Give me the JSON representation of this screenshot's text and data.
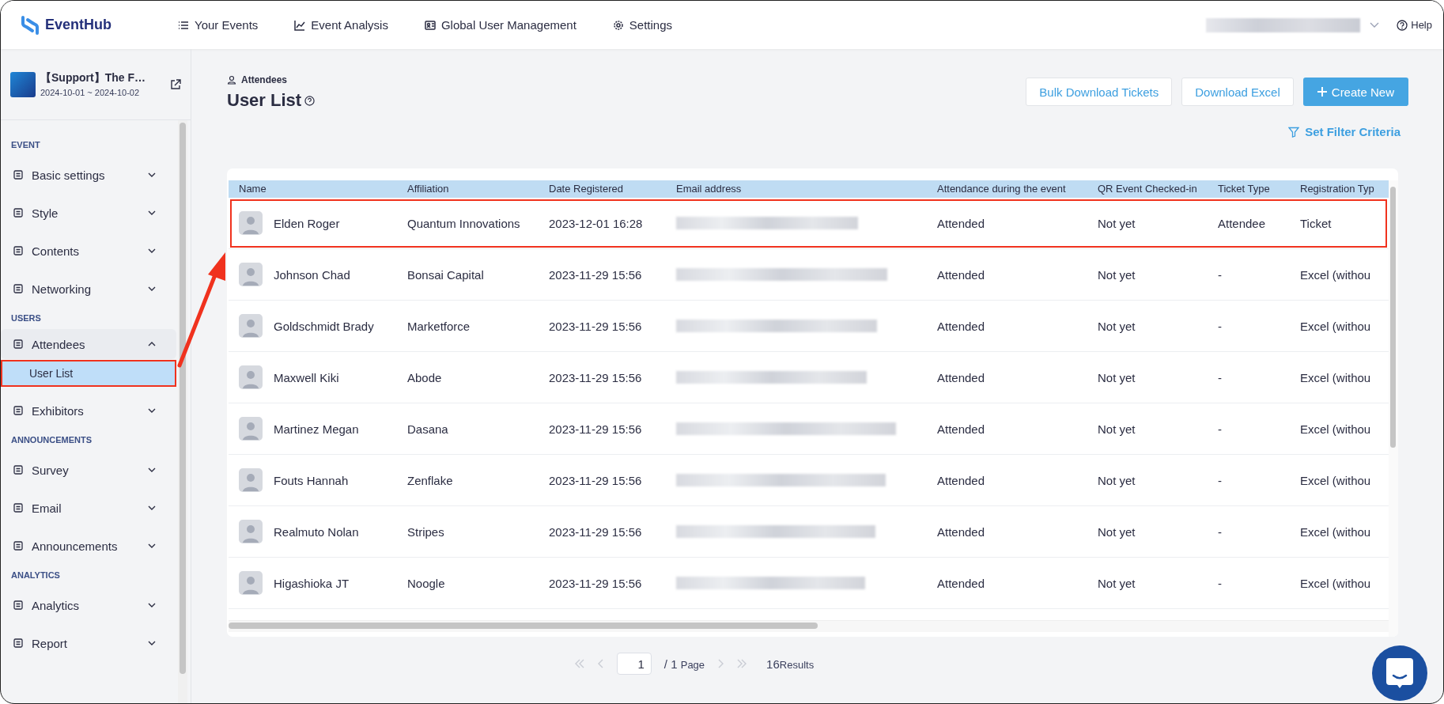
{
  "app": {
    "name": "EventHub",
    "nav": [
      "Your Events",
      "Event Analysis",
      "Global User Management",
      "Settings"
    ],
    "help": "Help"
  },
  "event": {
    "title": "【Support】The F…",
    "dates": "2024-10-01 ~ 2024-10-02"
  },
  "sidebar": {
    "sections": [
      {
        "label": "EVENT",
        "items": [
          {
            "label": "Basic settings",
            "expanded": false
          },
          {
            "label": "Style",
            "expanded": false
          },
          {
            "label": "Contents",
            "expanded": false
          },
          {
            "label": "Networking",
            "expanded": false
          }
        ]
      },
      {
        "label": "USERS",
        "items": [
          {
            "label": "Attendees",
            "expanded": true,
            "children": [
              {
                "label": "User List",
                "selected": true,
                "highlighted": true
              }
            ]
          },
          {
            "label": "Exhibitors",
            "expanded": false
          }
        ]
      },
      {
        "label": "ANNOUNCEMENTS",
        "items": [
          {
            "label": "Survey",
            "expanded": false
          },
          {
            "label": "Email",
            "expanded": false
          },
          {
            "label": "Announcements",
            "expanded": false
          }
        ]
      },
      {
        "label": "ANALYTICS",
        "items": [
          {
            "label": "Analytics",
            "expanded": false
          },
          {
            "label": "Report",
            "expanded": false
          }
        ]
      }
    ]
  },
  "page": {
    "breadcrumb": "Attendees",
    "title": "User List",
    "buttons": [
      {
        "label": "Bulk Download Tickets",
        "kind": "outline"
      },
      {
        "label": "Download Excel",
        "kind": "outline"
      },
      {
        "label": "Create New",
        "kind": "primary"
      }
    ],
    "filter": "Set Filter Criteria"
  },
  "table": {
    "columns": [
      "Name",
      "Affiliation",
      "Date Registered",
      "Email address",
      "Attendance during the event",
      "QR Event Checked-in",
      "Ticket Type",
      "Registration Typ"
    ],
    "rows": [
      {
        "highlighted": true,
        "cells": [
          "Elden Roger",
          "Quantum Innovations",
          "2023-12-01 16:28",
          "",
          "Attended",
          "Not yet",
          "Attendee",
          "Ticket"
        ]
      },
      {
        "highlighted": false,
        "cells": [
          "Johnson Chad",
          "Bonsai Capital",
          "2023-11-29 15:56",
          "",
          "Attended",
          "Not yet",
          "-",
          "Excel (withou"
        ]
      },
      {
        "highlighted": false,
        "cells": [
          "Goldschmidt Brady",
          "Marketforce",
          "2023-11-29 15:56",
          "",
          "Attended",
          "Not yet",
          "-",
          "Excel (withou"
        ]
      },
      {
        "highlighted": false,
        "cells": [
          "Maxwell Kiki",
          "Abode",
          "2023-11-29 15:56",
          "",
          "Attended",
          "Not yet",
          "-",
          "Excel (withou"
        ]
      },
      {
        "highlighted": false,
        "cells": [
          "Martinez Megan",
          "Dasana",
          "2023-11-29 15:56",
          "",
          "Attended",
          "Not yet",
          "-",
          "Excel (withou"
        ]
      },
      {
        "highlighted": false,
        "cells": [
          "Fouts Hannah",
          "Zenflake",
          "2023-11-29 15:56",
          "",
          "Attended",
          "Not yet",
          "-",
          "Excel (withou"
        ]
      },
      {
        "highlighted": false,
        "cells": [
          "Realmuto Nolan",
          "Stripes",
          "2023-11-29 15:56",
          "",
          "Attended",
          "Not yet",
          "-",
          "Excel (withou"
        ]
      },
      {
        "highlighted": false,
        "cells": [
          "Higashioka JT",
          "Noogle",
          "2023-11-29 15:56",
          "",
          "Attended",
          "Not yet",
          "-",
          "Excel (withou"
        ]
      }
    ]
  },
  "pagination": {
    "page": "1",
    "of": "/ 1",
    "page_label": "Page",
    "count": "16",
    "count_label": "Results"
  }
}
